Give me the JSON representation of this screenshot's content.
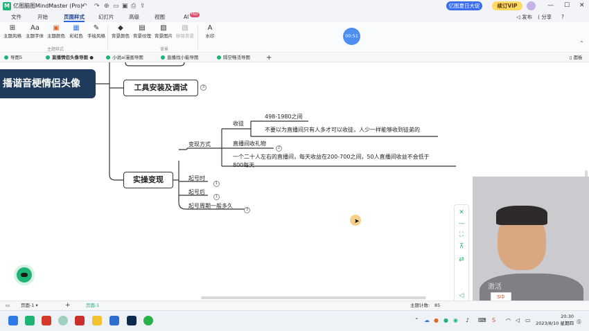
{
  "app": {
    "title": "亿图脑图MindMaster (Pro)",
    "promo_label": "亿图夏日大促",
    "vip_label": "续订VIP",
    "window_controls": [
      "—",
      "☐",
      "✕"
    ]
  },
  "menu": {
    "items": [
      "文件",
      "开始",
      "页面样式",
      "幻灯片",
      "高级",
      "视图",
      "AI"
    ],
    "active": "页面样式",
    "ai_badge": "Hot",
    "right": [
      "发布",
      "分享",
      "?"
    ]
  },
  "ribbon": {
    "tools": [
      {
        "label": "主题风格",
        "icon": "⊞"
      },
      {
        "label": "主题字体",
        "icon": "Aa"
      },
      {
        "label": "主题颜色",
        "icon": "▣"
      },
      {
        "label": "彩虹色",
        "icon": "▦"
      },
      {
        "label": "手绘风格",
        "icon": "✎"
      },
      {
        "label": "背景颜色",
        "icon": "◆"
      },
      {
        "label": "背景纹理",
        "icon": "▤"
      },
      {
        "label": "背景图片",
        "icon": "▨"
      },
      {
        "label": "移除背景",
        "icon": "▧"
      },
      {
        "label": "水印",
        "icon": "A"
      }
    ],
    "groups": {
      "theme": "主题样式",
      "background": "背景"
    },
    "timer": "00:51"
  },
  "tabs": [
    "导图5",
    "直播情侣头像导图",
    "小说ai漫画导图",
    "直播找小能导图",
    "隔空畅活导图"
  ],
  "tabs_right": "面板",
  "mindmap": {
    "root": "播谐音梗情侣头像",
    "branch_tools": "工具安装及调试",
    "branch_tools_badge": "3",
    "branch_monetize": "实操变现",
    "monetize_way": "变现方式",
    "income": "收徒",
    "income_range": "498-1980之间",
    "income_note": "不要以为直播间只有人多才可以收徒，人少一样能够收到徒弟的",
    "gift": "直播间收礼物",
    "gift_badge": "2",
    "gift_note_line1": "一个二十人左右的直播间，每天收益在200-700之间，50人直播间收益不会低于",
    "gift_note_line2": "800每天",
    "start_time": "起号时",
    "start_time_badge": "1",
    "after_start": "起号后",
    "after_start_badge": "1",
    "start_cycle": "起号周期一般多久",
    "start_cycle_badge": "3"
  },
  "statusbar": {
    "page_select": "页面-1",
    "active_page": "页面-1",
    "topic_count_label": "主题计数:",
    "topic_count": "85"
  },
  "video": {
    "watermark": "激活"
  },
  "ime": "S中",
  "clock": {
    "time": "20:30",
    "date": "2023/8/10 星期四"
  }
}
